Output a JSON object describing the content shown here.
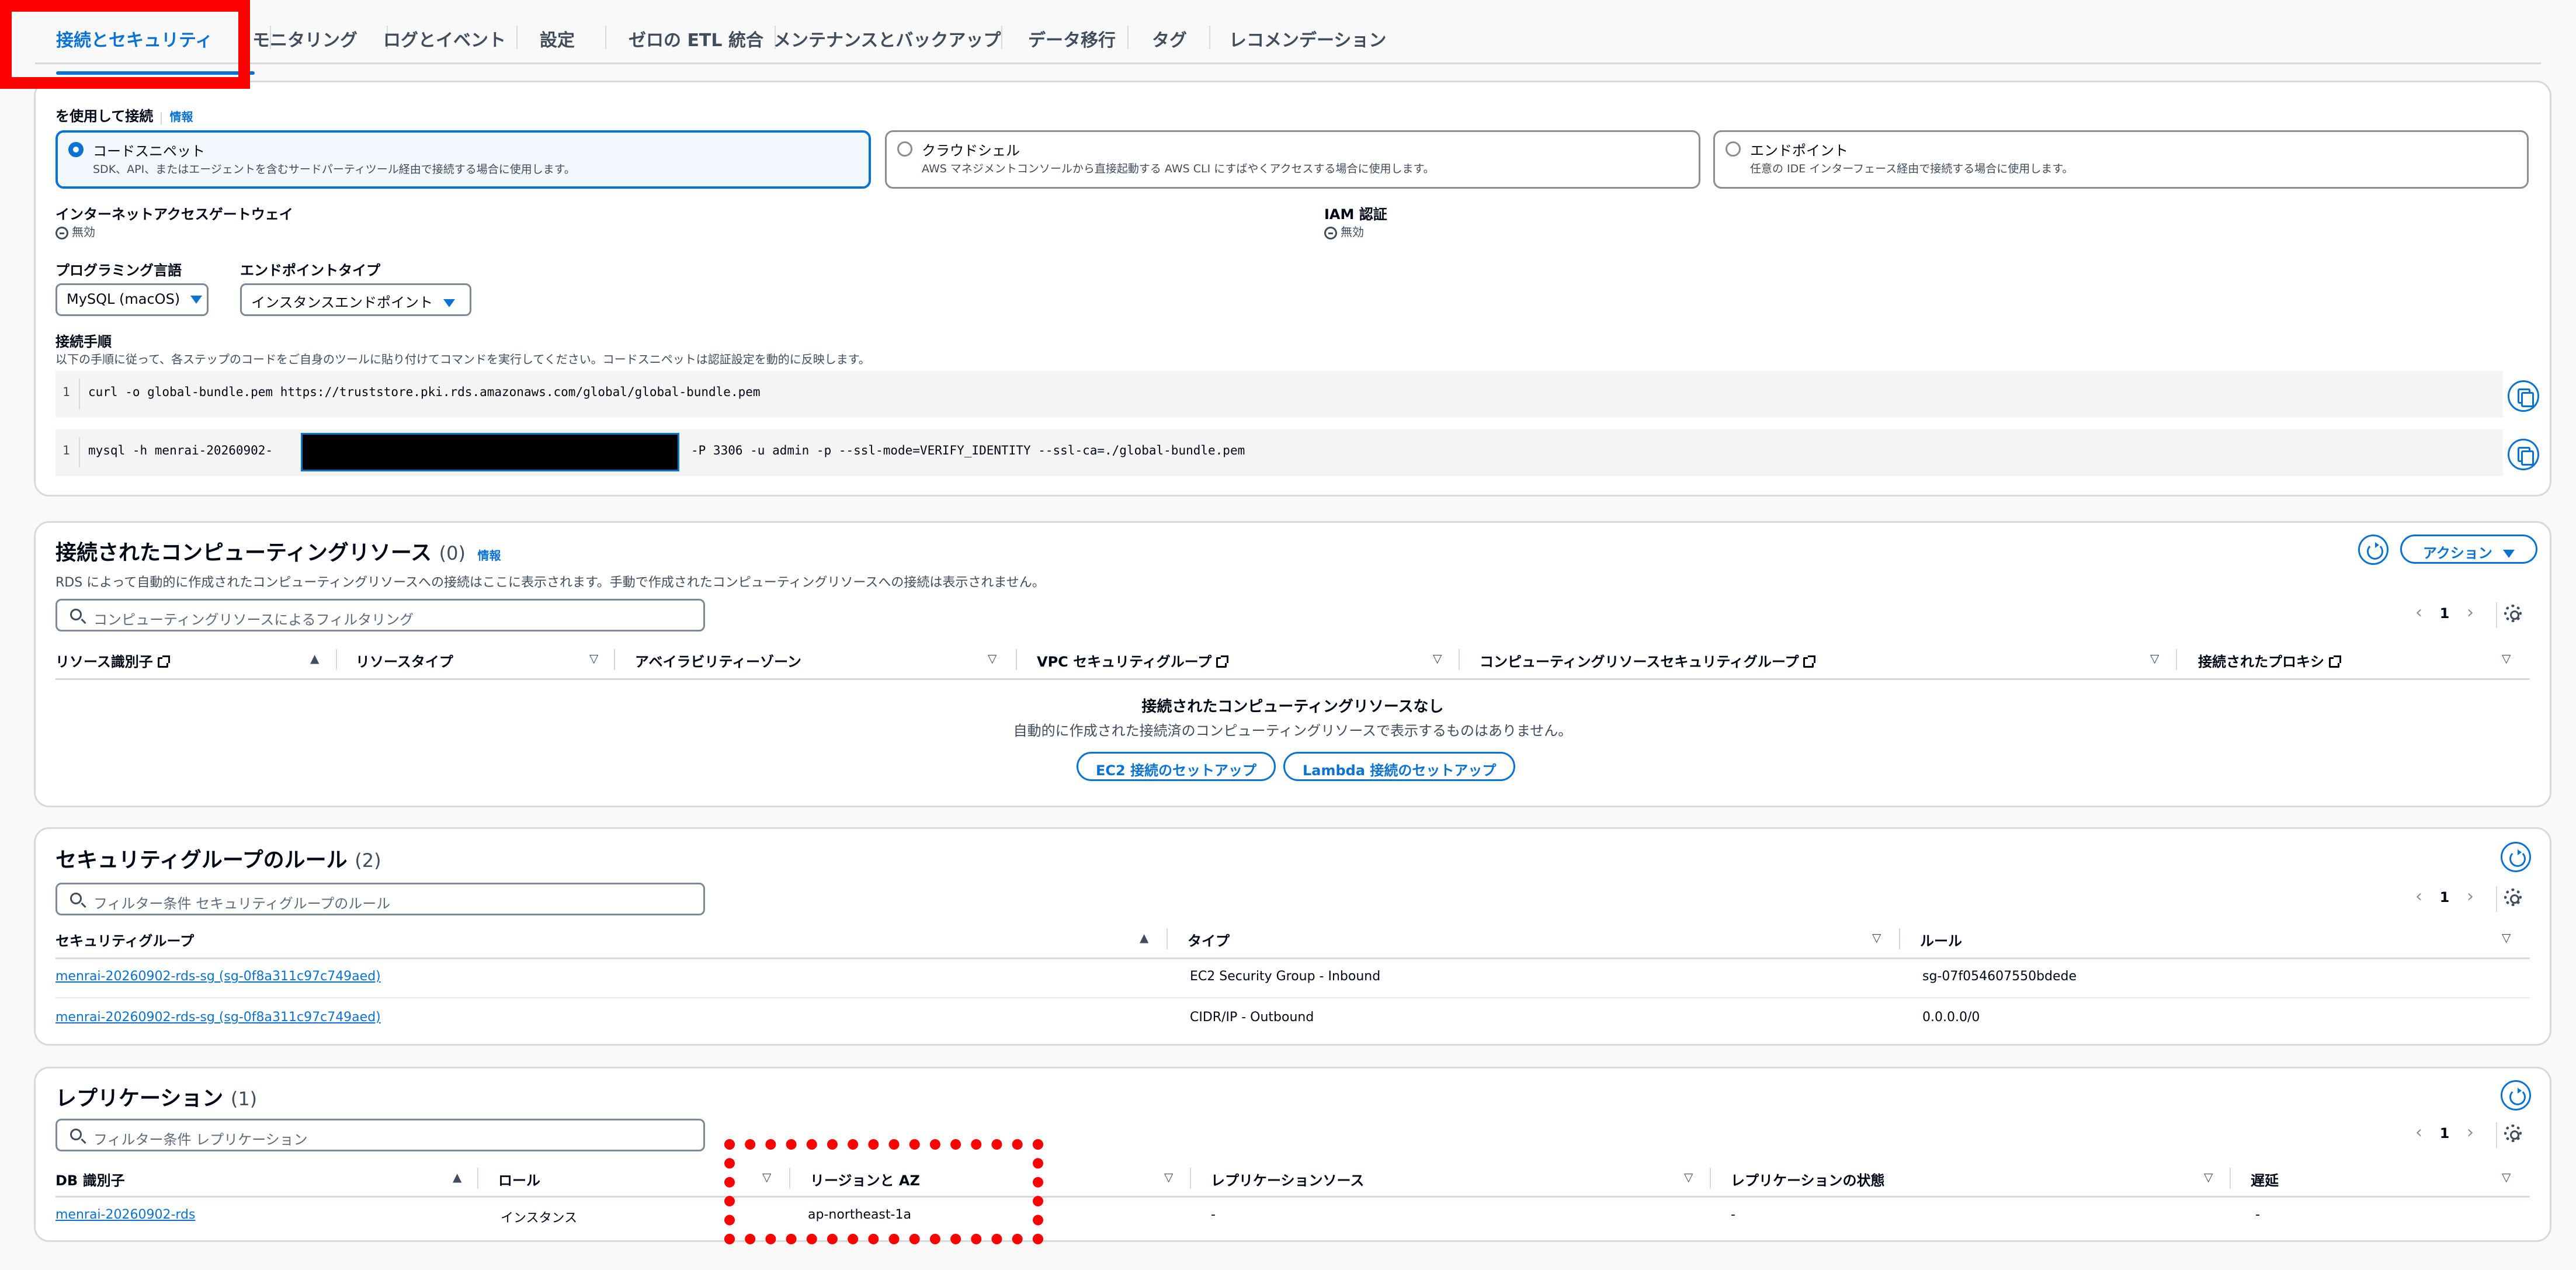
{
  "tabs": [
    "接続とセキュリティ",
    "モニタリング",
    "ログとイベント",
    "設定",
    "ゼロの ETL 統合",
    "メンテナンスとバックアップ",
    "データ移行",
    "タグ",
    "レコメンデーション"
  ],
  "connect": {
    "heading": "を使用して接続",
    "info": "情報",
    "tiles": [
      {
        "title": "コードスニペット",
        "desc": "SDK、API、またはエージェントを含むサードパーティツール経由で接続する場合に使用します。"
      },
      {
        "title": "クラウドシェル",
        "desc": "AWS マネジメントコンソールから直接起動する AWS CLI にすばやくアクセスする場合に使用します。"
      },
      {
        "title": "エンドポイント",
        "desc": "任意の IDE インターフェース経由で接続する場合に使用します。"
      }
    ],
    "igw_label": "インターネットアクセスゲートウェイ",
    "igw_value": "無効",
    "iam_label": "IAM 認証",
    "iam_value": "無効",
    "lang_label": "プログラミング言語",
    "lang_value": "MySQL (macOS)",
    "endpoint_type_label": "エンドポイントタイプ",
    "endpoint_type_value": "インスタンスエンドポイント",
    "steps_label": "接続手順",
    "steps_desc": "以下の手順に従って、各ステップのコードをご自身のツールに貼り付けてコマンドを実行してください。コードスニペットは認証設定を動的に反映します。",
    "code1_ln": "1",
    "code1": "curl -o global-bundle.pem https://truststore.pki.rds.amazonaws.com/global/global-bundle.pem",
    "code2_ln": "1",
    "code2_a": "mysql -h menrai-20260902-",
    "code2_b": "-P 3306 -u admin -p --ssl-mode=VERIFY_IDENTITY --ssl-ca=./global-bundle.pem"
  },
  "compute": {
    "title": "接続されたコンピューティングリソース",
    "count": "(0)",
    "info": "情報",
    "desc": "RDS によって自動的に作成されたコンピューティングリソースへの接続はここに表示されます。手動で作成されたコンピューティングリソースへの接続は表示されません。",
    "actions": "アクション",
    "filter_placeholder": "コンピューティングリソースによるフィルタリング",
    "page": "1",
    "columns": [
      "リソース識別子",
      "リソースタイプ",
      "アベイラビリティーゾーン",
      "VPC セキュリティグループ",
      "コンピューティングリソースセキュリティグループ",
      "接続されたプロキシ"
    ],
    "empty_title": "接続されたコンピューティングリソースなし",
    "empty_desc": "自動的に作成された接続済のコンピューティングリソースで表示するものはありません。",
    "btn_ec2": "EC2 接続のセットアップ",
    "btn_lambda": "Lambda 接続のセットアップ"
  },
  "sg": {
    "title": "セキュリティグループのルール",
    "count": "(2)",
    "filter_placeholder": "フィルター条件 セキュリティグループのルール",
    "page": "1",
    "columns": [
      "セキュリティグループ",
      "タイプ",
      "ルール"
    ],
    "rows": [
      {
        "group": "menrai-20260902-rds-sg (sg-0f8a311c97c749aed)",
        "type": "EC2 Security Group - Inbound",
        "rule": "sg-07f054607550bdede"
      },
      {
        "group": "menrai-20260902-rds-sg (sg-0f8a311c97c749aed)",
        "type": "CIDR/IP - Outbound",
        "rule": "0.0.0.0/0"
      }
    ]
  },
  "repl": {
    "title": "レプリケーション",
    "count": "(1)",
    "filter_placeholder": "フィルター条件 レプリケーション",
    "page": "1",
    "columns": [
      "DB 識別子",
      "ロール",
      "リージョンと AZ",
      "レプリケーションソース",
      "レプリケーションの状態",
      "遅延"
    ],
    "rows": [
      {
        "id": "menrai-20260902-rds",
        "role": "インスタンス",
        "region": "ap-northeast-1a",
        "source": "-",
        "state": "-",
        "lag": "-"
      }
    ]
  },
  "colors": {
    "accent": "#0972d3",
    "highlight": "#ff0000",
    "border": "#d5dbdb"
  }
}
